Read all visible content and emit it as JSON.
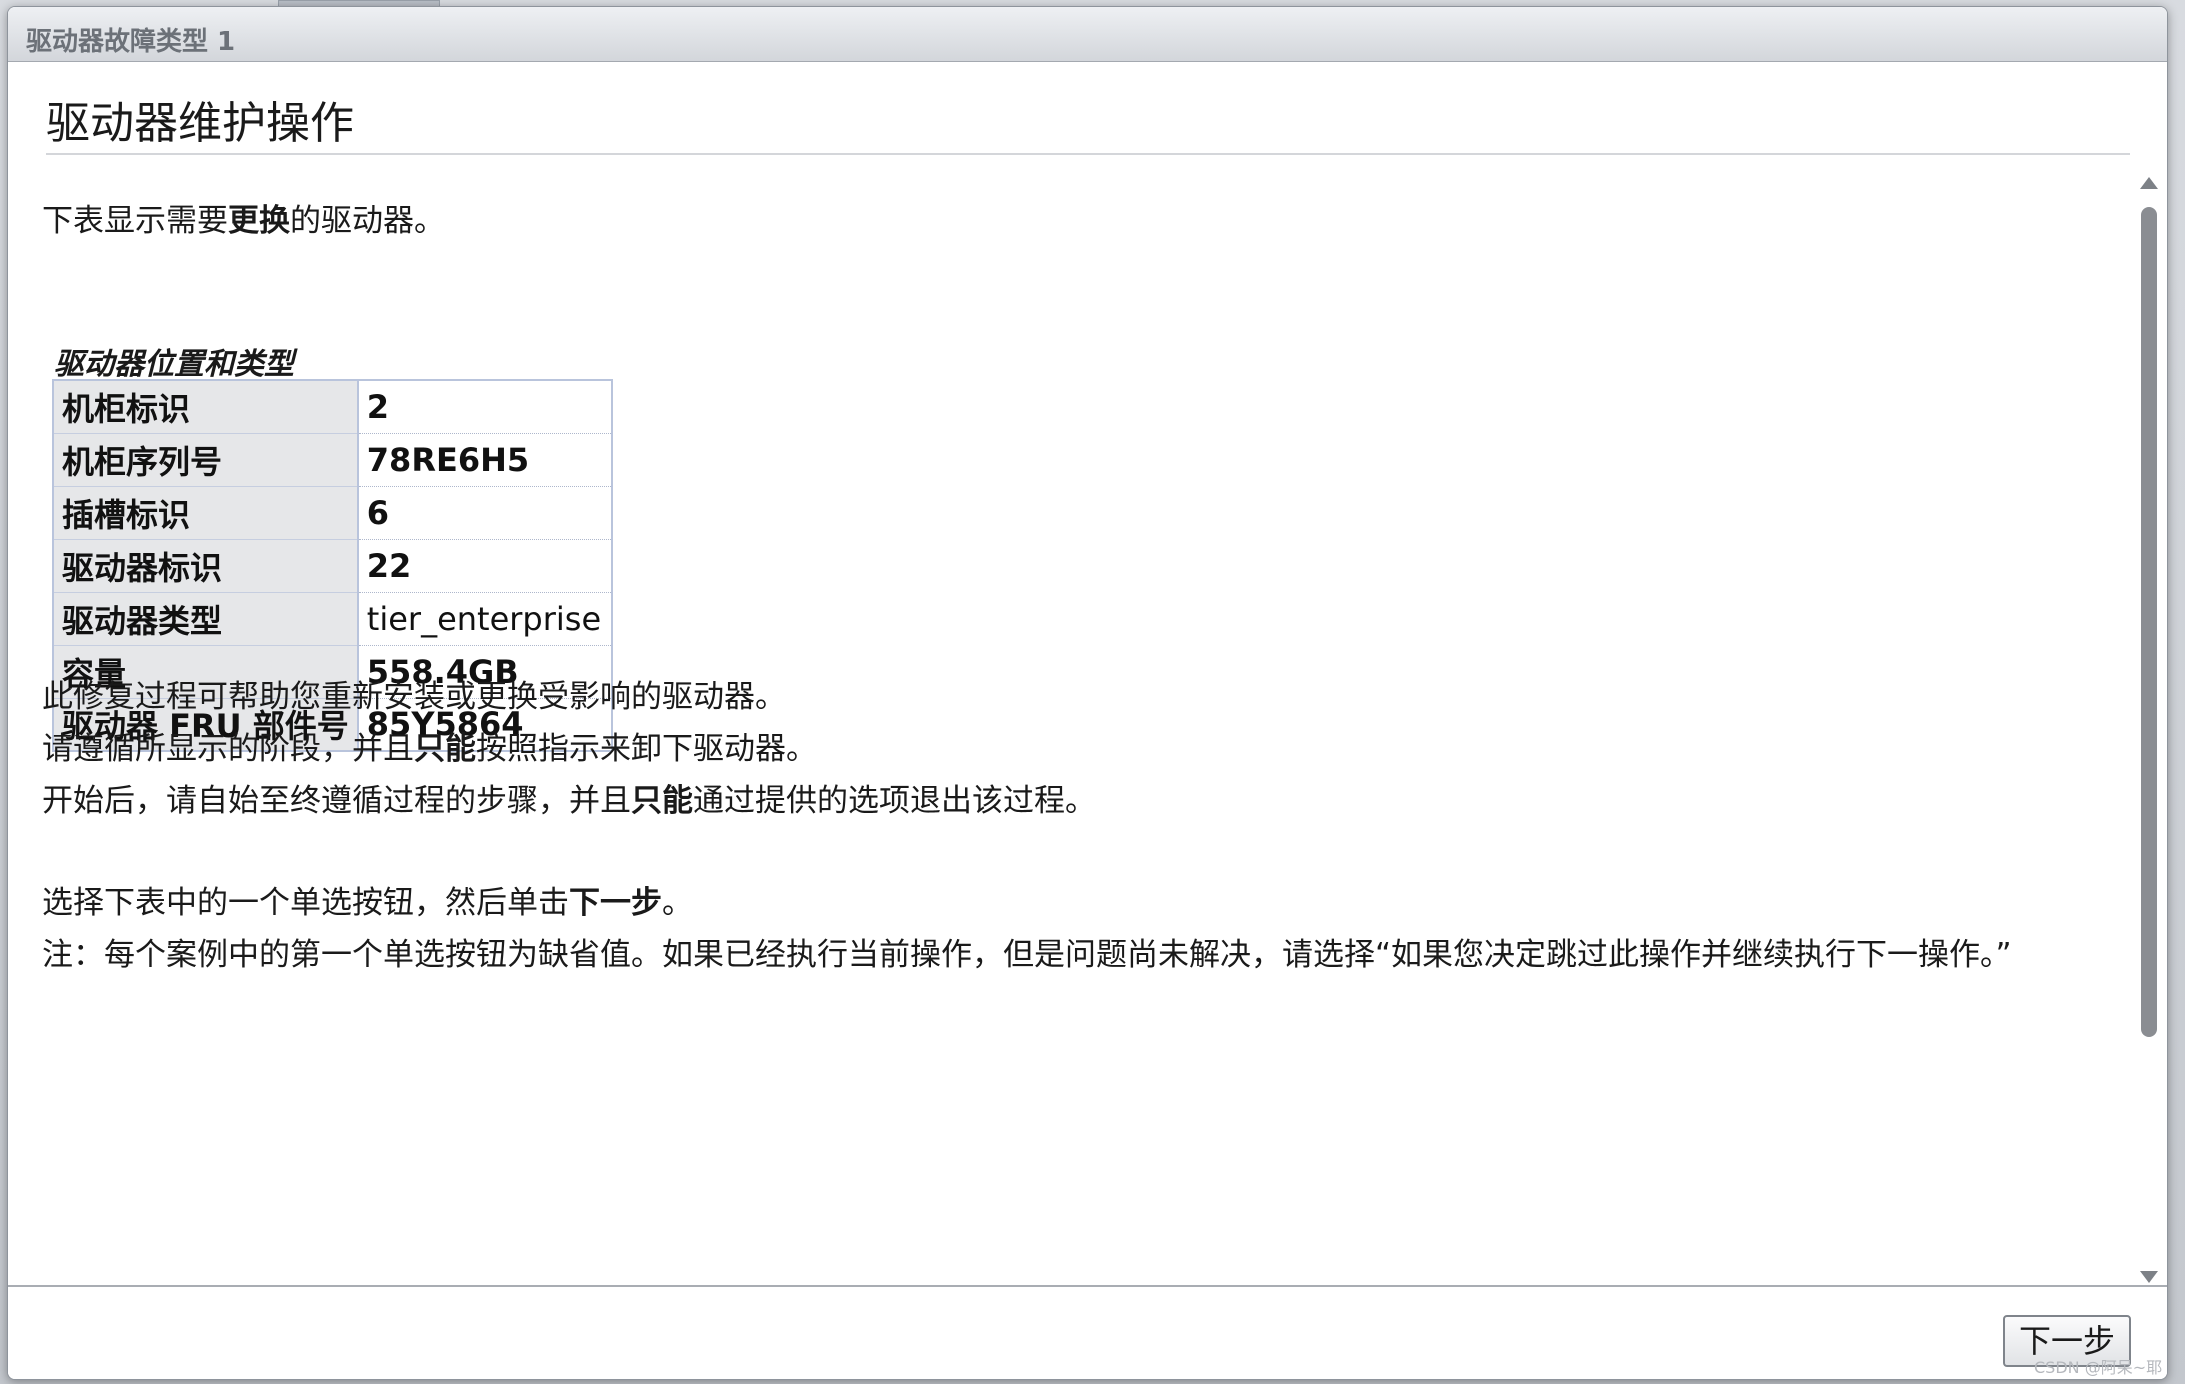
{
  "window": {
    "title": "驱动器故障类型 1"
  },
  "header": {
    "title": "驱动器维护操作"
  },
  "intro": {
    "before": "下表显示需要",
    "bold": "更换",
    "after": "的驱动器。"
  },
  "drive_table": {
    "caption": "驱动器位置和类型",
    "rows": [
      {
        "label": "机柜标识",
        "value": "2"
      },
      {
        "label": "机柜序列号",
        "value": "78RE6H5"
      },
      {
        "label": "插槽标识",
        "value": "6"
      },
      {
        "label": "驱动器标识",
        "value": "22"
      },
      {
        "label": "驱动器类型",
        "value": "tier_enterprise"
      },
      {
        "label": "容量",
        "value": "558.4GB"
      },
      {
        "label": "驱动器 FRU 部件号",
        "value": "85Y5864"
      }
    ]
  },
  "paragraphs": {
    "p1": "此修复过程可帮助您重新安装或更换受影响的驱动器。",
    "p2": {
      "before": "请遵循所显示的阶段，并且",
      "bold": "只能",
      "after": "按照指示来卸下驱动器。"
    },
    "p3": {
      "before": "开始后，请自始至终遵循过程的步骤，并且",
      "bold": "只能",
      "after": "通过提供的选项退出该过程。"
    },
    "p4": {
      "before": "选择下表中的一个单选按钮，然后单击",
      "bold": "下一步",
      "after": "。"
    },
    "note": "注：每个案例中的第一个单选按钮为缺省值。如果已经执行当前操作，但是问题尚未解决，请选择“如果您决定跳过此操作并继续执行下一操作。”"
  },
  "footer": {
    "next_label": "下一步"
  },
  "watermark": "CSDN @阿呆~耶"
}
